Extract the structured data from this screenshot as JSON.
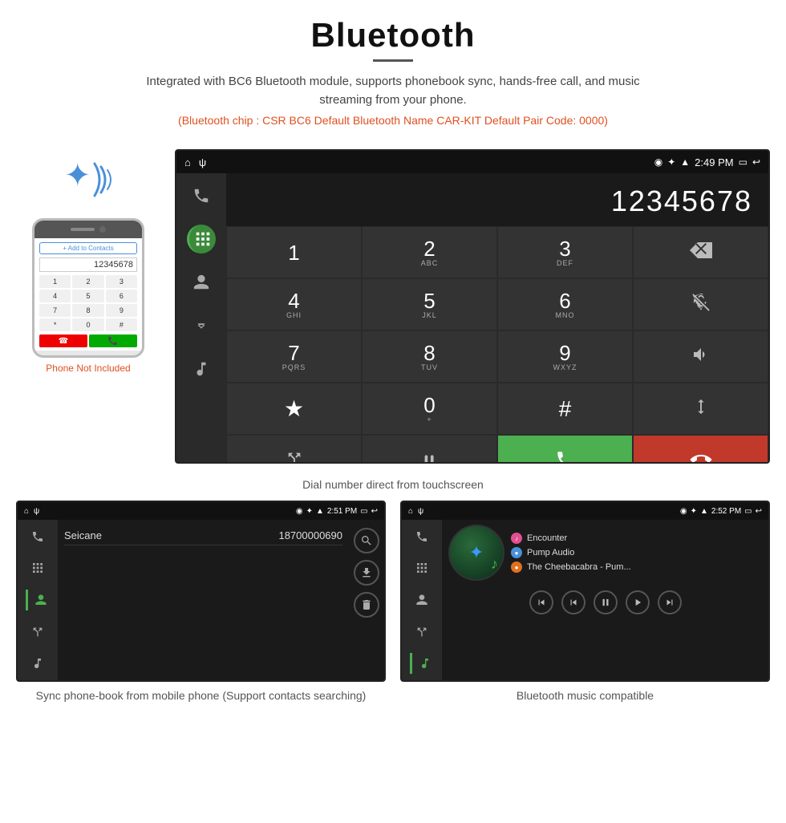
{
  "header": {
    "title": "Bluetooth",
    "subtitle": "Integrated with BC6 Bluetooth module, supports phonebook sync, hands-free call, and music streaming from your phone.",
    "spec_line": "(Bluetooth chip : CSR BC6    Default Bluetooth Name CAR-KIT    Default Pair Code: 0000)"
  },
  "phone": {
    "not_included": "Phone Not Included",
    "number": "12345678",
    "add_contacts_label": "+ Add to Contacts",
    "keys": [
      "1",
      "2",
      "3",
      "4",
      "5",
      "6",
      "*",
      "0",
      "#"
    ]
  },
  "main_screen": {
    "status": {
      "left_icons": [
        "⌂",
        "ψ"
      ],
      "right_info": "2:49 PM",
      "right_icons": [
        "◉",
        "✦",
        "▲",
        "▭",
        "↩"
      ]
    },
    "number_display": "12345678",
    "caption": "Dial number direct from touchscreen",
    "keypad": [
      {
        "main": "1",
        "sub": ""
      },
      {
        "main": "2",
        "sub": "ABC"
      },
      {
        "main": "3",
        "sub": "DEF"
      },
      {
        "main": "⌫",
        "sub": ""
      },
      {
        "main": "4",
        "sub": "GHI"
      },
      {
        "main": "5",
        "sub": "JKL"
      },
      {
        "main": "6",
        "sub": "MNO"
      },
      {
        "main": "🎤",
        "sub": ""
      },
      {
        "main": "7",
        "sub": "PQRS"
      },
      {
        "main": "8",
        "sub": "TUV"
      },
      {
        "main": "9",
        "sub": "WXYZ"
      },
      {
        "main": "🔊",
        "sub": ""
      },
      {
        "main": "★",
        "sub": ""
      },
      {
        "main": "0",
        "sub": "+"
      },
      {
        "main": "#",
        "sub": ""
      },
      {
        "main": "⇅",
        "sub": ""
      },
      {
        "main": "✦",
        "sub": ""
      },
      {
        "main": "ω",
        "sub": ""
      },
      {
        "main": "📞",
        "sub": ""
      },
      {
        "main": "📵",
        "sub": ""
      }
    ]
  },
  "phonebook_screen": {
    "status_time": "2:51 PM",
    "contact_name": "Seicane",
    "contact_number": "18700000690",
    "caption": "Sync phone-book from mobile phone\n(Support contacts searching)"
  },
  "music_screen": {
    "status_time": "2:52 PM",
    "tracks": [
      {
        "name": "Encounter",
        "dot_color": "music"
      },
      {
        "name": "Pump Audio",
        "dot_color": "blue"
      },
      {
        "name": "The Cheebacabra - Pum...",
        "dot_color": "orange"
      }
    ],
    "caption": "Bluetooth music compatible"
  },
  "sidebar_icons": {
    "phone": "📞",
    "keypad": "⊞",
    "contacts": "👤",
    "call_transfer": "↗",
    "music": "♪"
  }
}
